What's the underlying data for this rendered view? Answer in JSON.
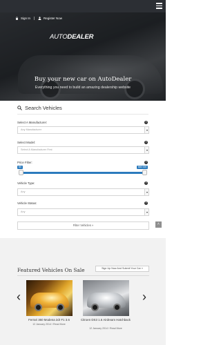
{
  "header": {
    "sign_in": "Sign In",
    "register": "Register Now",
    "logo_light": "AUTO",
    "logo_bold": "DEALER"
  },
  "hero": {
    "title": "Buy your new car on AutoDealer",
    "subtitle": "Everything you need to build an amazing dealership website"
  },
  "search": {
    "title": "Search Vehicles",
    "fields": [
      {
        "label": "Select A Manufacturer:",
        "value": "Any Manufacturer"
      },
      {
        "label": "Select Model:",
        "value": "Select A Manufacturer First"
      },
      {
        "label": "Price Filter:",
        "min_value": "$0",
        "max_value": "$80 000",
        "min_fraction": 0.0,
        "max_fraction": 1.0
      },
      {
        "label": "Vehicle Type:",
        "value": "Any"
      },
      {
        "label": "Vehicle Status:",
        "value": "Any"
      }
    ],
    "help_glyph": "?",
    "filter_button": "Filter Vehicles »",
    "scroll_top": "˄"
  },
  "featured": {
    "title": "Featured Vehicles On Sale",
    "cta": "Sign Up Now And Submit Your Car »",
    "prev": "‹",
    "next": "›",
    "cars": [
      {
        "name": "Ferrari 360 Modena 2dr F1 3.6",
        "date": "12 January 2014",
        "read_more": "Read More"
      },
      {
        "name": "Citroen DS3 1.6 Airdream Hatchback",
        "date": "12 January 2014",
        "read_more": "Read More"
      }
    ],
    "meta_sep": "/"
  },
  "colors": {
    "topbar": "#2c2f34",
    "accent": "#2b7bbd",
    "featured_bg": "#f2f2f2"
  }
}
